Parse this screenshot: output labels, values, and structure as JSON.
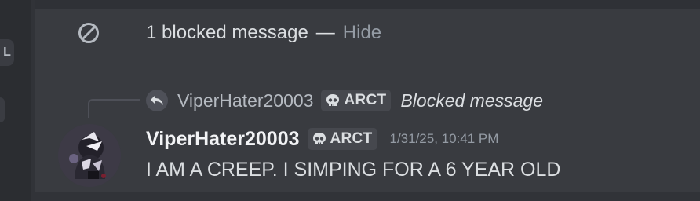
{
  "sidebar": {
    "badge_letter": "L"
  },
  "blocked_notice": {
    "icon": "block-icon",
    "text": "1 blocked message",
    "separator": "—",
    "hide_label": "Hide"
  },
  "reply": {
    "icon": "reply-arrow-icon",
    "author": "ViperHater20003",
    "tag": {
      "icon": "skull-icon",
      "label": "ARCT"
    },
    "content": "Blocked message"
  },
  "message": {
    "avatar": "user-avatar",
    "author": "ViperHater20003",
    "tag": {
      "icon": "skull-icon",
      "label": "ARCT"
    },
    "timestamp": "1/31/25, 10:41 PM",
    "content": "I AM A CREEP. I SIMPING FOR A 6 YEAR OLD"
  },
  "colors": {
    "background": "#313338",
    "pane": "#393b40",
    "muted": "#949ba4",
    "text": "#dbdee1",
    "author": "#f2f3f5"
  }
}
